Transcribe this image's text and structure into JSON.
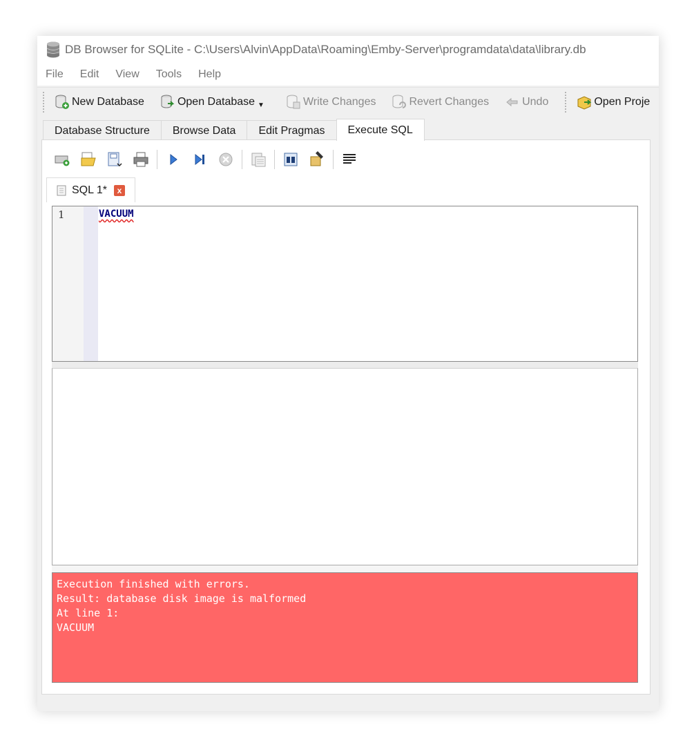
{
  "window": {
    "title": "DB Browser for SQLite - C:\\Users\\Alvin\\AppData\\Roaming\\Emby-Server\\programdata\\data\\library.db"
  },
  "menu": [
    "File",
    "Edit",
    "View",
    "Tools",
    "Help"
  ],
  "toolbar": {
    "new_database": "New Database",
    "open_database": "Open Database",
    "write_changes": "Write Changes",
    "revert_changes": "Revert Changes",
    "undo": "Undo",
    "open_project": "Open Proje"
  },
  "tabs": [
    {
      "label": "Database Structure",
      "active": false
    },
    {
      "label": "Browse Data",
      "active": false
    },
    {
      "label": "Edit Pragmas",
      "active": false
    },
    {
      "label": "Execute SQL",
      "active": true
    }
  ],
  "sql_toolbar_icons": [
    "open-tab-icon",
    "open-sql-file-icon",
    "save-sql-file-icon",
    "print-icon",
    "execute-all-icon",
    "execute-current-line-icon",
    "stop-execution-icon",
    "save-results-icon",
    "find-icon",
    "find-replace-icon",
    "comment-icon"
  ],
  "editor_tab": {
    "label": "SQL 1*",
    "close": "x"
  },
  "editor": {
    "line_number": "1",
    "code": "VACUUM"
  },
  "message": {
    "text": "Execution finished with errors.\nResult: database disk image is malformed\nAt line 1:\nVACUUM",
    "bg_color": "#ff6666"
  }
}
